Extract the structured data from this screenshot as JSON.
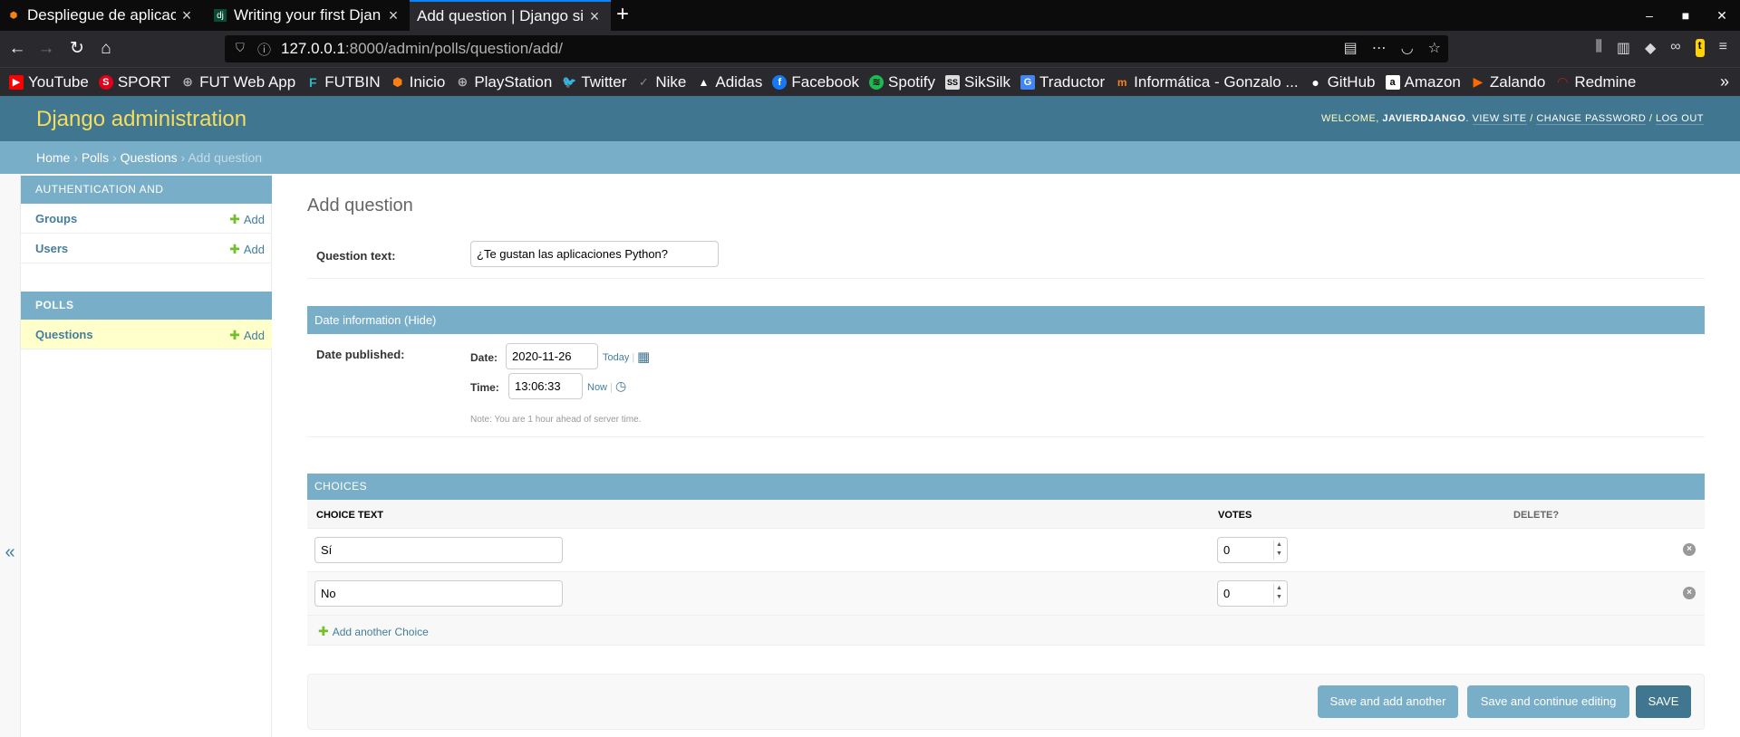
{
  "browser": {
    "tabs": [
      {
        "label": "Despliegue de aplicac",
        "favicon": "moodle-icon"
      },
      {
        "label": "Writing your first Djan",
        "favicon": "django-icon"
      },
      {
        "label": "Add question | Django si",
        "favicon": "",
        "active": true
      }
    ],
    "url_host": "127.0.0.1",
    "url_rest": ":8000/admin/polls/question/add/",
    "bookmarks": [
      {
        "label": "YouTube",
        "icon": "youtube-icon",
        "color": "#ff0000"
      },
      {
        "label": "SPORT",
        "icon": "sport-icon",
        "color": "#e3001b"
      },
      {
        "label": "FUT Web App",
        "icon": "globe-icon",
        "color": "#b1b1b3"
      },
      {
        "label": "FUTBIN",
        "icon": "futbin-icon",
        "color": "#29b6c6"
      },
      {
        "label": "Inicio",
        "icon": "moodle-icon",
        "color": "#f98012"
      },
      {
        "label": "PlayStation",
        "icon": "globe-icon",
        "color": "#b1b1b3"
      },
      {
        "label": "Twitter",
        "icon": "twitter-icon",
        "color": "#1da1f2"
      },
      {
        "label": "Nike",
        "icon": "nike-icon",
        "color": "#888888"
      },
      {
        "label": "Adidas",
        "icon": "adidas-icon",
        "color": "#ffffff"
      },
      {
        "label": "Facebook",
        "icon": "facebook-icon",
        "color": "#1877f2"
      },
      {
        "label": "Spotify",
        "icon": "spotify-icon",
        "color": "#1db954"
      },
      {
        "label": "SikSilk",
        "icon": "siksilk-icon",
        "color": "#dddddd"
      },
      {
        "label": "Traductor",
        "icon": "translate-icon",
        "color": "#4285f4"
      },
      {
        "label": "Informática - Gonzalo ...",
        "icon": "moodle-icon",
        "color": "#f98012"
      },
      {
        "label": "GitHub",
        "icon": "github-icon",
        "color": "#ffffff"
      },
      {
        "label": "Amazon",
        "icon": "amazon-icon",
        "color": "#ffffff"
      },
      {
        "label": "Zalando",
        "icon": "zalando-icon",
        "color": "#ff6900"
      },
      {
        "label": "Redmine",
        "icon": "redmine-icon",
        "color": "#b32024"
      }
    ]
  },
  "admin": {
    "branding": "Django administration",
    "welcome": "Welcome,",
    "username": "javierdjango",
    "view_site": "View site",
    "change_password": "Change password",
    "log_out": "Log out",
    "breadcrumbs": {
      "home": "Home",
      "polls": "Polls",
      "questions": "Questions",
      "current": "Add question"
    },
    "sidebar": {
      "auth_caption": "Authentication and Authorization",
      "groups": "Groups",
      "users": "Users",
      "polls_caption": "Polls",
      "questions": "Questions",
      "add": "Add",
      "toggle": "«"
    },
    "title": "Add question",
    "question_text_label": "Question text:",
    "question_text_value": "¿Te gustan las aplicaciones Python?",
    "date_fieldset": "Date information (Hide)",
    "date_published_label": "Date published:",
    "date_label": "Date:",
    "date_value": "2020-11-26",
    "today": "Today",
    "time_label": "Time:",
    "time_value": "13:06:33",
    "now": "Now",
    "note": "Note: You are 1 hour ahead of server time.",
    "choices_header": "Choices",
    "col_choice_text": "Choice text",
    "col_votes": "Votes",
    "col_delete": "Delete?",
    "choices": [
      {
        "text": "Sí",
        "votes": "0"
      },
      {
        "text": "No",
        "votes": "0"
      }
    ],
    "add_another": "Add another Choice",
    "save_add_another": "Save and add another",
    "save_continue": "Save and continue editing",
    "save": "SAVE"
  }
}
